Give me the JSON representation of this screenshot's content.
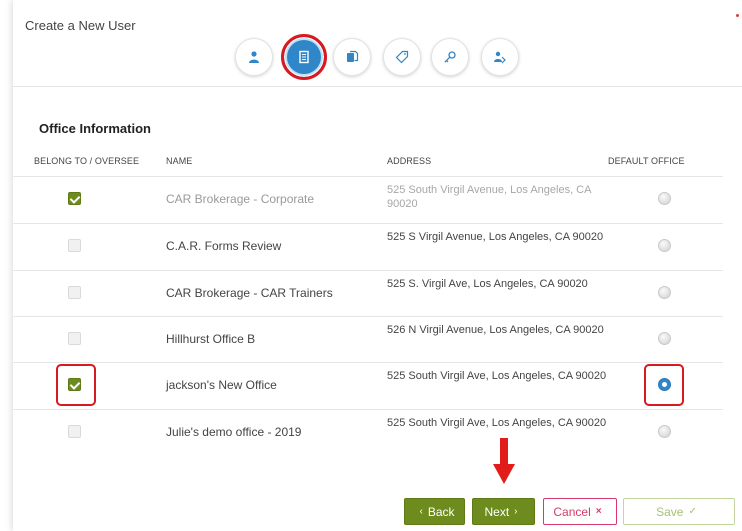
{
  "dialog": {
    "title": "Create a New User"
  },
  "steps": [
    {
      "icon": "person-icon",
      "active": false
    },
    {
      "icon": "office-building-icon",
      "active": true
    },
    {
      "icon": "documents-icon",
      "active": false
    },
    {
      "icon": "tag-icon",
      "active": false
    },
    {
      "icon": "key-icon",
      "active": false
    },
    {
      "icon": "users-share-icon",
      "active": false
    }
  ],
  "section": {
    "title": "Office Information"
  },
  "table": {
    "headers": {
      "belong": "BELONG TO / OVERSEE",
      "name": "NAME",
      "address": "ADDRESS",
      "default": "DEFAULT OFFICE"
    },
    "rows": [
      {
        "name": "CAR Brokerage - Corporate",
        "address": "525 South Virgil Avenue, Los Angeles, CA 90020",
        "checked": true,
        "default": false,
        "muted": true
      },
      {
        "name": "C.A.R. Forms Review",
        "address": "525 S Virgil Avenue, Los Angeles, CA 90020",
        "checked": false,
        "default": false,
        "muted": false
      },
      {
        "name": "CAR Brokerage - CAR Trainers",
        "address": "525 S. Virgil Ave, Los Angeles, CA 90020",
        "checked": false,
        "default": false,
        "muted": false
      },
      {
        "name": "Hillhurst Office B",
        "address": "526 N Virgil Avenue, Los Angeles, CA 90020",
        "checked": false,
        "default": false,
        "muted": false
      },
      {
        "name": "jackson's New Office",
        "address": "525 South Virgil Ave, Los Angeles, CA 90020",
        "checked": true,
        "default": true,
        "muted": false
      },
      {
        "name": "Julie's demo office - 2019",
        "address": "525 South Virgil Ave, Los Angeles, CA 90020",
        "checked": false,
        "default": false,
        "muted": false
      }
    ]
  },
  "footer": {
    "back_label": "Back",
    "back_symbol": "‹",
    "next_label": "Next",
    "next_symbol": "›",
    "cancel_label": "Cancel",
    "cancel_symbol": "×",
    "save_label": "Save",
    "save_symbol": "✓"
  },
  "colors": {
    "accent_green": "#6e8c1d",
    "accent_blue": "#2f86c9",
    "highlight_red": "#d71920",
    "cancel_pink": "#d63b6b"
  }
}
